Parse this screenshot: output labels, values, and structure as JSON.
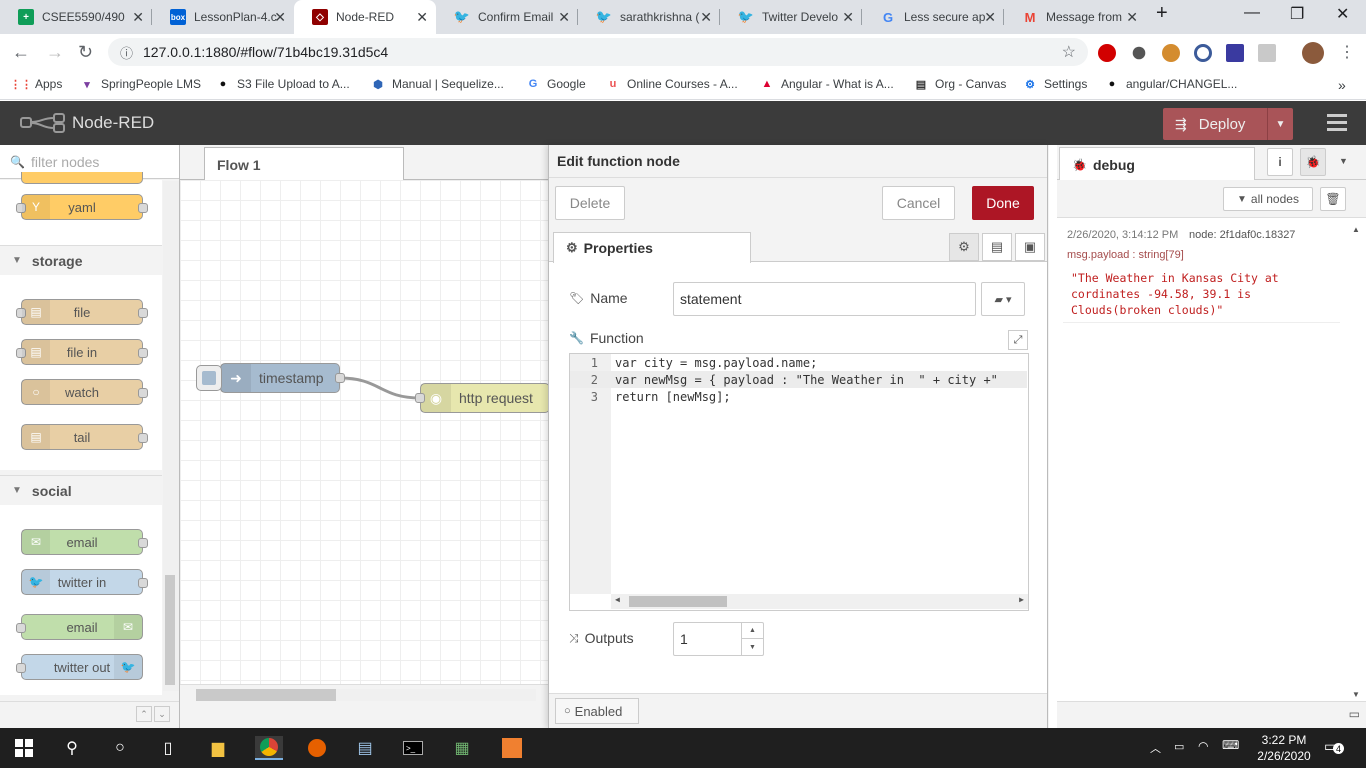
{
  "browser": {
    "tabs": [
      {
        "label": "CSEE5590/490",
        "icon": "sheets-icon",
        "color": "#0f9d58"
      },
      {
        "label": "LessonPlan-4.c",
        "icon": "box-icon",
        "color": "#0061d5"
      },
      {
        "label": "Node-RED",
        "icon": "node-red-icon",
        "color": "#8f0000"
      },
      {
        "label": "Confirm Email",
        "icon": "twitter-icon",
        "color": "#1da1f2"
      },
      {
        "label": "sarathkrishna (",
        "icon": "twitter-icon",
        "color": "#1da1f2"
      },
      {
        "label": "Twitter Develo",
        "icon": "twitter-icon",
        "color": "#1da1f2"
      },
      {
        "label": "Less secure ap",
        "icon": "google-icon",
        "color": "#4285f4"
      },
      {
        "label": "Message from",
        "icon": "gmail-icon",
        "color": "#ea4335"
      }
    ],
    "url": "127.0.0.1:1880/#flow/71b4bc19.31d5c4",
    "bookmarks": [
      {
        "label": "Apps",
        "icon": "apps-grid-icon"
      },
      {
        "label": "SpringPeople LMS",
        "icon": "springpeople-icon"
      },
      {
        "label": "S3 File Upload to A...",
        "icon": "github-icon"
      },
      {
        "label": "Manual | Sequelize...",
        "icon": "sequelize-icon"
      },
      {
        "label": "Google",
        "icon": "google-icon"
      },
      {
        "label": "Online Courses - A...",
        "icon": "udemy-icon"
      },
      {
        "label": "Angular - What is A...",
        "icon": "angular-icon"
      },
      {
        "label": "Org - Canvas",
        "icon": "document-icon"
      },
      {
        "label": "Settings",
        "icon": "gear-icon"
      },
      {
        "label": "angular/CHANGEL...",
        "icon": "github-icon"
      }
    ]
  },
  "header": {
    "title": "Node-RED",
    "deploy_label": "Deploy"
  },
  "palette": {
    "filter_placeholder": "filter nodes",
    "categories": {
      "storage": "storage",
      "social": "social"
    },
    "nodes": {
      "yaml": "yaml",
      "file": "file",
      "file_in": "file in",
      "watch": "watch",
      "tail": "tail",
      "email_in": "email",
      "twitter_in": "twitter in",
      "email_out": "email",
      "twitter_out": "twitter out"
    }
  },
  "workspace": {
    "tab": "Flow 1",
    "nodes": {
      "timestamp": "timestamp",
      "http_request": "http request"
    }
  },
  "editor": {
    "title": "Edit function node",
    "delete_label": "Delete",
    "cancel_label": "Cancel",
    "done_label": "Done",
    "properties_tab": "Properties",
    "name_label": "Name",
    "name_value": "statement",
    "function_label": "Function",
    "code": [
      {
        "num": "1",
        "text": "var city = msg.payload.name;"
      },
      {
        "num": "2",
        "text": "var newMsg = { payload : \"The Weather in  \" + city +\""
      },
      {
        "num": "3",
        "text": "return [newMsg];"
      }
    ],
    "outputs_label": "Outputs",
    "outputs_value": "1",
    "enabled_label": "Enabled"
  },
  "sidebar": {
    "tab": "debug",
    "filter_label": "all nodes",
    "message": {
      "timestamp": "2/26/2020, 3:14:12 PM",
      "node": "node: 2f1daf0c.18327",
      "type": "msg.payload : string[79]",
      "value": "\"The Weather in Kansas City at cordinates -94.58, 39.1 is Clouds(broken clouds)\""
    }
  },
  "taskbar": {
    "time": "3:22 PM",
    "date": "2/26/2020",
    "notifications": "4"
  },
  "colors": {
    "accent": "#ad1625",
    "header": "#3b3b3b",
    "deploy": "#a95458",
    "debug_text": "#c02020"
  }
}
